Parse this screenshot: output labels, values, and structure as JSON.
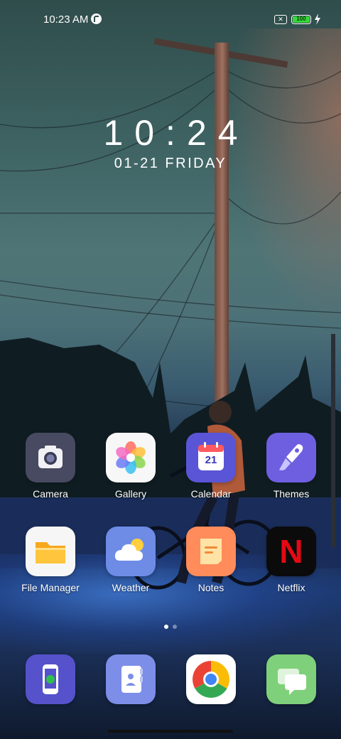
{
  "status_bar": {
    "time": "10:23 AM",
    "sim_glyph": "✕",
    "battery": "100",
    "icons": [
      "notification-icon",
      "sim-missing-icon",
      "battery-icon",
      "charging-bolt-icon"
    ]
  },
  "lock_clock": {
    "time": "10:24",
    "date": "01-21 FRIDAY"
  },
  "home_apps": [
    {
      "label": "Camera",
      "icon": "camera-icon"
    },
    {
      "label": "Gallery",
      "icon": "gallery-flower-icon"
    },
    {
      "label": "Calendar",
      "icon": "calendar-icon",
      "day": "21"
    },
    {
      "label": "Themes",
      "icon": "themes-brush-icon"
    },
    {
      "label": "File Manager",
      "icon": "folder-icon"
    },
    {
      "label": "Weather",
      "icon": "weather-cloud-icon"
    },
    {
      "label": "Notes",
      "icon": "notes-icon"
    },
    {
      "label": "Netflix",
      "icon": "netflix-icon",
      "glyph": "N"
    }
  ],
  "page_indicator": {
    "pages": 2,
    "active": 1
  },
  "dock": [
    {
      "icon": "phone-icon"
    },
    {
      "icon": "contacts-icon"
    },
    {
      "icon": "chrome-icon"
    },
    {
      "icon": "messages-icon"
    }
  ],
  "colors": {
    "battery": "#37d83a",
    "netflix": "#e50914",
    "sky_top": "#2f4d4b",
    "ground": "#1d3970"
  }
}
